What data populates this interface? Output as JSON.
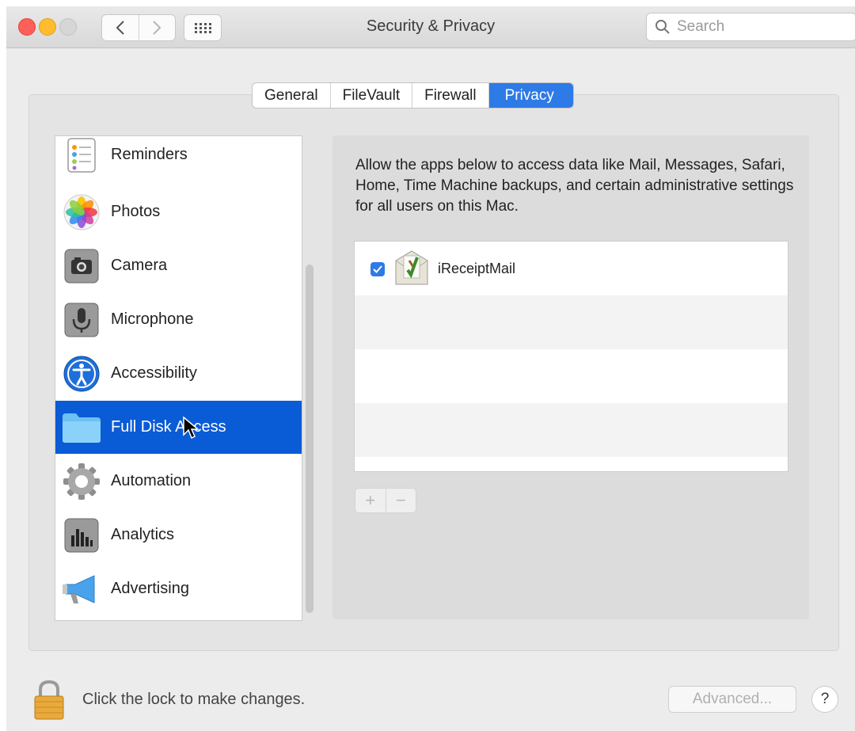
{
  "window": {
    "title": "Security & Privacy",
    "search_placeholder": "Search"
  },
  "tabs": [
    {
      "label": "General",
      "active": false
    },
    {
      "label": "FileVault",
      "active": false
    },
    {
      "label": "Firewall",
      "active": false
    },
    {
      "label": "Privacy",
      "active": true
    }
  ],
  "categories": [
    {
      "label": "Reminders",
      "icon": "reminders-icon"
    },
    {
      "label": "Photos",
      "icon": "photos-icon"
    },
    {
      "label": "Camera",
      "icon": "camera-icon"
    },
    {
      "label": "Microphone",
      "icon": "microphone-icon"
    },
    {
      "label": "Accessibility",
      "icon": "accessibility-icon"
    },
    {
      "label": "Full Disk Access",
      "icon": "folder-icon",
      "selected": true
    },
    {
      "label": "Automation",
      "icon": "gear-icon"
    },
    {
      "label": "Analytics",
      "icon": "analytics-icon"
    },
    {
      "label": "Advertising",
      "icon": "megaphone-icon"
    }
  ],
  "main": {
    "description": "Allow the apps below to access data like Mail, Messages, Safari, Home, Time Machine backups, and certain administrative settings for all users on this Mac.",
    "apps": [
      {
        "name": "iReceiptMail",
        "checked": true,
        "icon": "ireceiptmail-icon"
      }
    ],
    "add_label": "+",
    "remove_label": "−"
  },
  "footer": {
    "lock_text": "Click the lock to make changes.",
    "advanced_label": "Advanced...",
    "help_label": "?"
  },
  "colors": {
    "accent": "#2e7ae6",
    "selection": "#0a5bd6"
  }
}
